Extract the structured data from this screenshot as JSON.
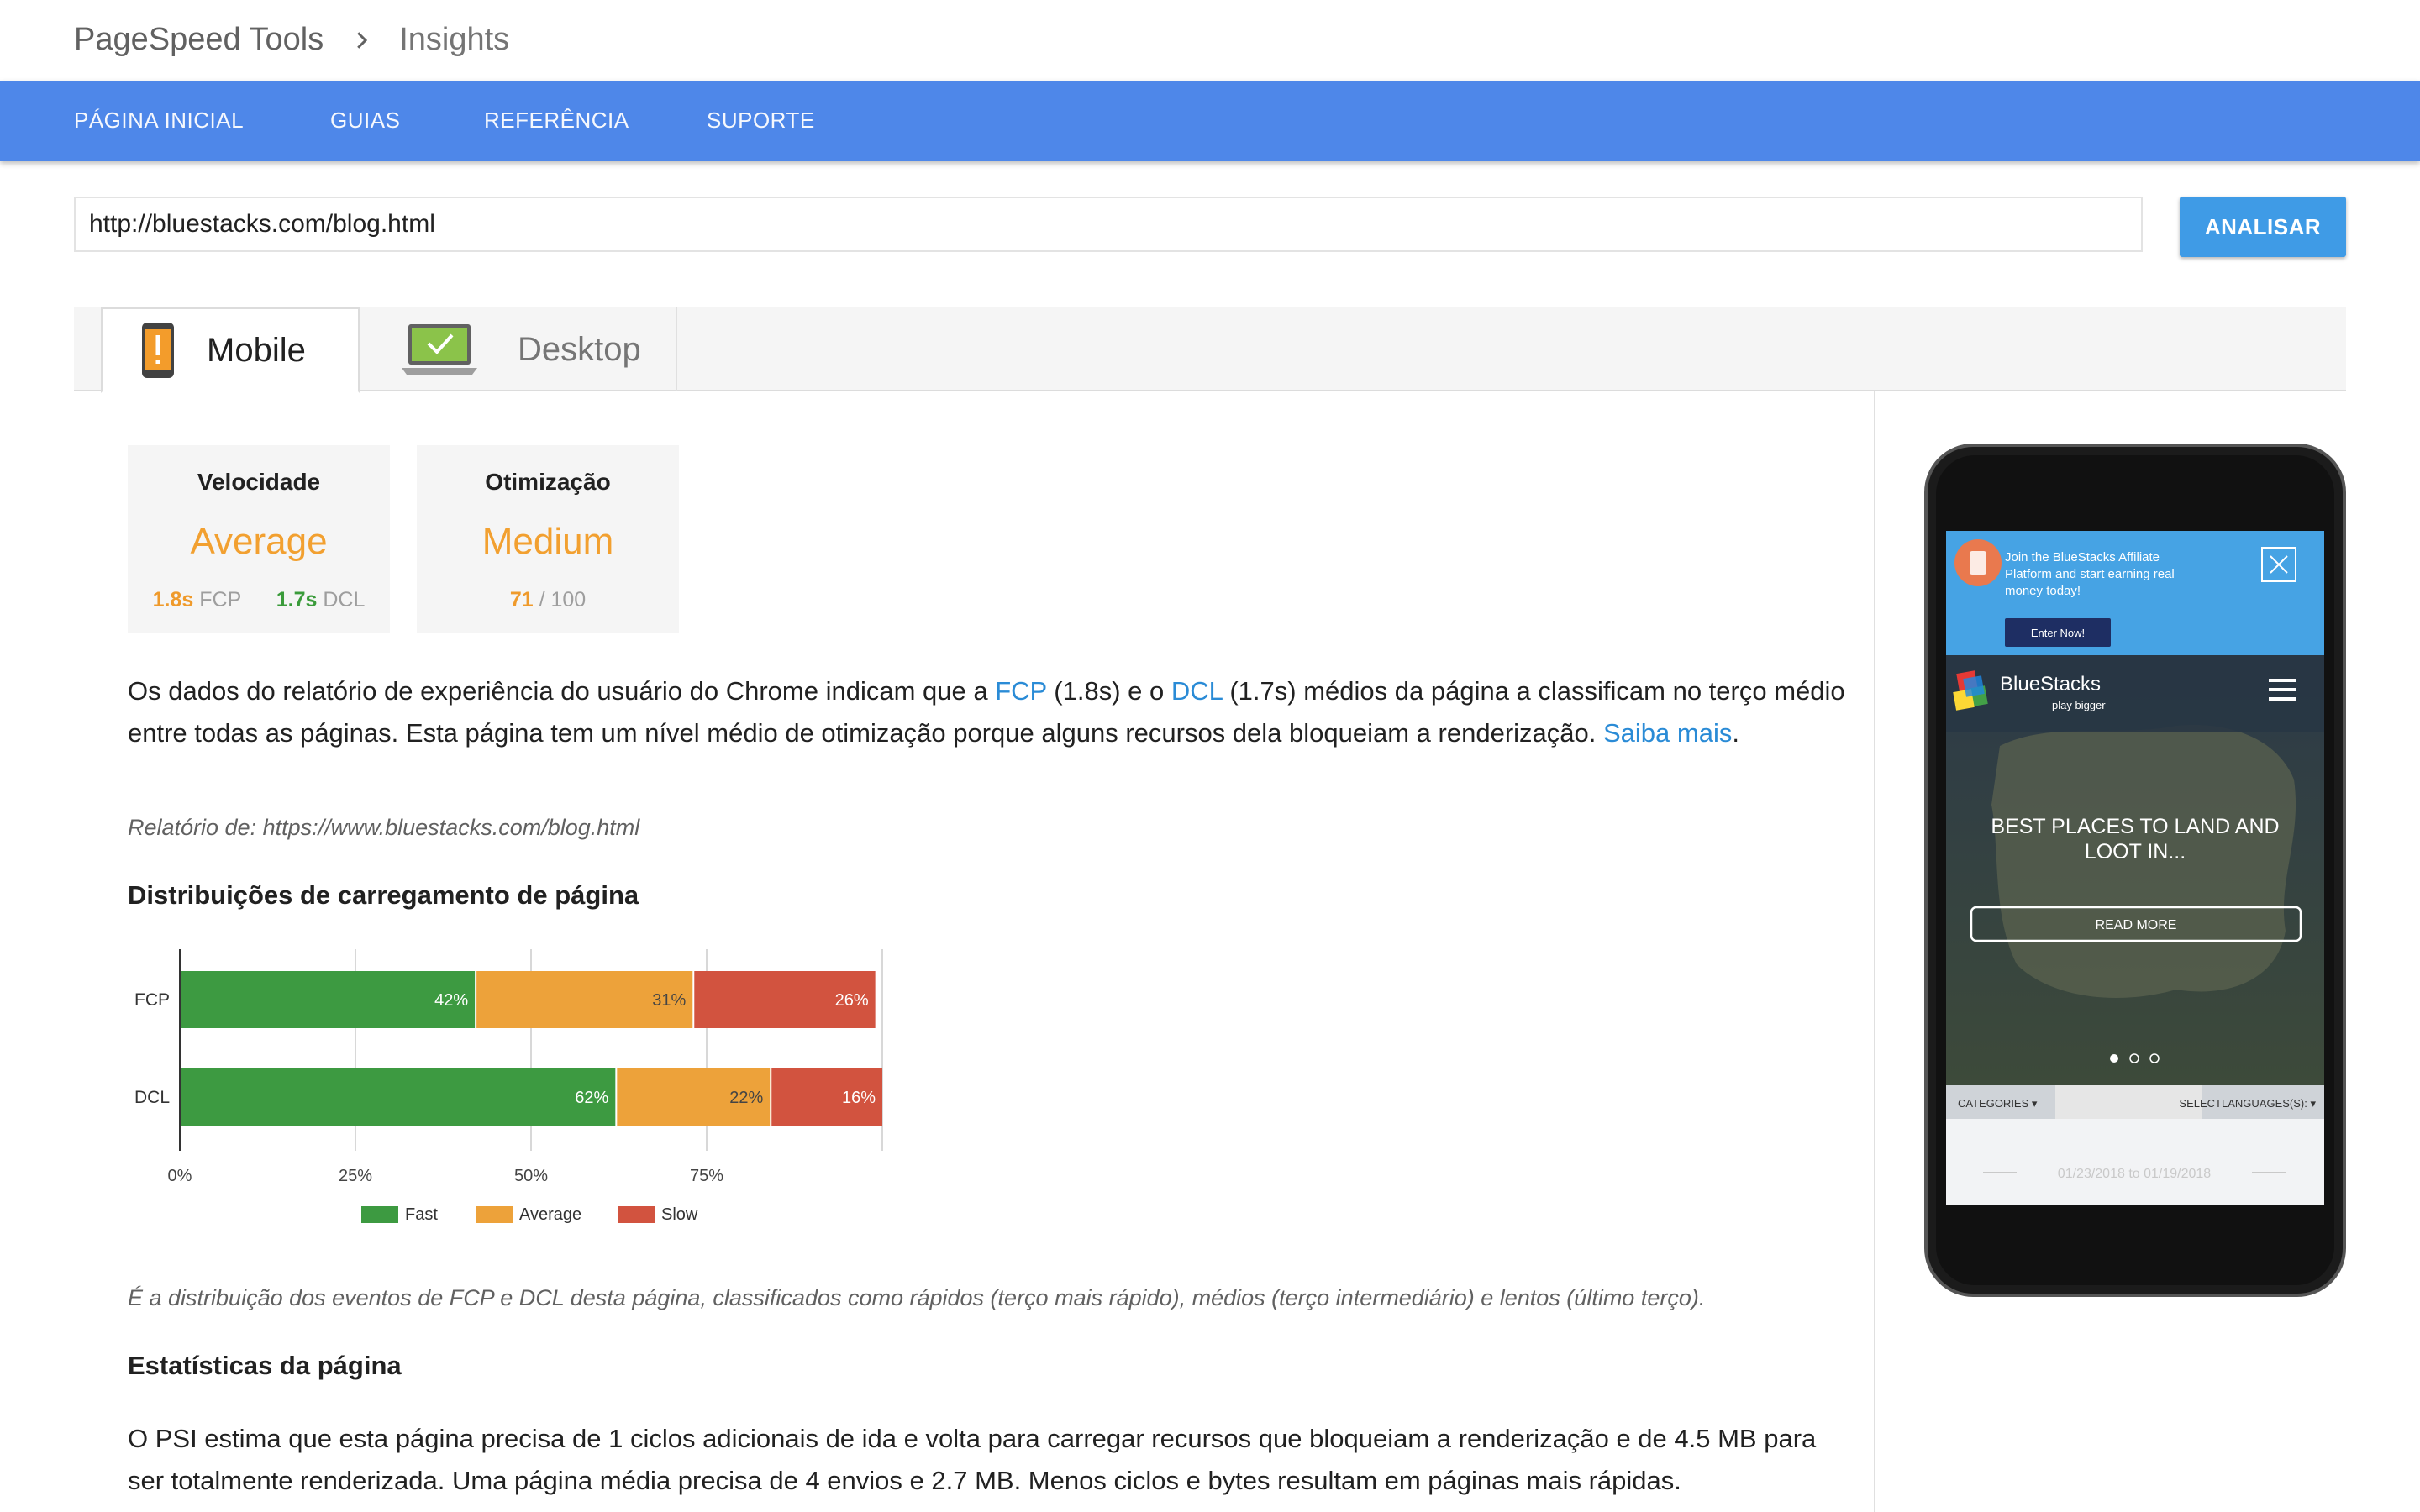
{
  "breadcrumb": {
    "parent": "PageSpeed Tools",
    "current": "Insights"
  },
  "nav": {
    "items": [
      "PÁGINA INICIAL",
      "GUIAS",
      "REFERÊNCIA",
      "SUPORTE"
    ]
  },
  "search": {
    "url_value": "http://bluestacks.com/blog.html",
    "button_label": "ANALISAR"
  },
  "tabs": {
    "mobile": "Mobile",
    "desktop": "Desktop"
  },
  "cards": {
    "speed": {
      "title": "Velocidade",
      "value": "Average",
      "fcp_value": "1.8s",
      "fcp_label": "FCP",
      "dcl_value": "1.7s",
      "dcl_label": "DCL"
    },
    "optimization": {
      "title": "Otimização",
      "value": "Medium",
      "score": "71",
      "score_max": "/ 100"
    }
  },
  "summary": {
    "p1": "Os dados do relatório de experiência do usuário do Chrome indicam que a ",
    "fcp_link": "FCP",
    "p2": " (1.8s) e o ",
    "dcl_link": "DCL",
    "p3": " (1.7s) médios da página a classificam no terço médio entre todas as páginas. Esta página tem um nível médio de otimização porque alguns recursos dela bloqueiam a renderização. ",
    "learn_more": "Saiba mais",
    "end": "."
  },
  "report_source": "Relatório de: https://www.bluestacks.com/blog.html",
  "distribution_heading": "Distribuições de carregamento de página",
  "chart_data": {
    "type": "bar",
    "orientation": "horizontal-stacked",
    "categories": [
      "FCP",
      "DCL"
    ],
    "series": [
      {
        "name": "Fast",
        "values": [
          42,
          62
        ],
        "labels": [
          "42%",
          "62%"
        ],
        "color": "#3d9a41"
      },
      {
        "name": "Average",
        "values": [
          31,
          22
        ],
        "labels": [
          "31%",
          "22%"
        ],
        "color": "#eda23a"
      },
      {
        "name": "Slow",
        "values": [
          26,
          16
        ],
        "labels": [
          "26%",
          "16%"
        ],
        "color": "#d2533f"
      }
    ],
    "x_ticks": [
      "0%",
      "25%",
      "50%",
      "75%"
    ],
    "xlim": [
      0,
      100
    ],
    "legend_position": "bottom",
    "grid": true
  },
  "distribution_caption": "É a distribuição dos eventos de FCP e DCL desta página, classificados como rápidos (terço mais rápido), médios (terço intermediário) e lentos (último terço).",
  "stats_heading": "Estatísticas da página",
  "stats_text": "O PSI estima que esta página precisa de 1 ciclos adicionais de ida e volta para carregar recursos que bloqueiam a renderização e de 4.5 MB para ser totalmente renderizada. Uma página média precisa de 4 envios e 2.7 MB. Menos ciclos e bytes resultam em páginas mais rápidas.",
  "phone_preview": {
    "banner_text": "Join the BlueStacks Affiliate Platform and start earning real money today!",
    "banner_button": "Enter Now!",
    "brand": "BlueStacks",
    "tagline": "play bigger",
    "hero_title_line1": "BEST PLACES TO LAND AND",
    "hero_title_line2": "LOOT IN...",
    "read_more": "READ MORE",
    "categories": "CATEGORIES ▾",
    "select_languages": "SELECTLANGUAGES(S): ▾",
    "date_range": "01/23/2018 to 01/19/2018"
  },
  "colors": {
    "nav_blue": "#4e87e9",
    "button_blue": "#3f9be6",
    "average_orange": "#f2a030",
    "link_blue": "#2a8bd6"
  }
}
